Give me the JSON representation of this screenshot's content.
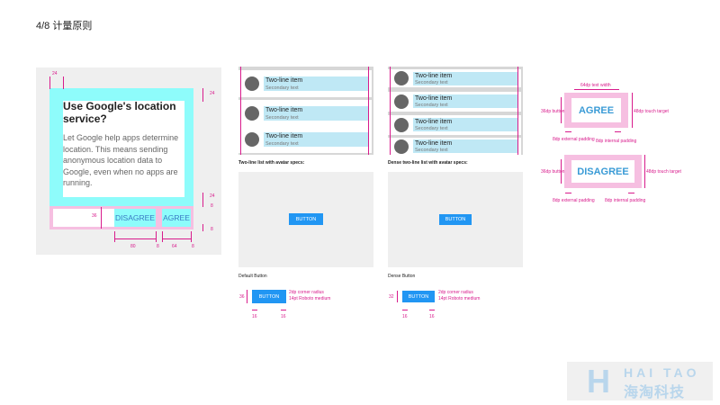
{
  "page_title": "4/8 计量原则",
  "dialog": {
    "title": "Use Google's location service?",
    "body": "Let Google help apps determine location. This means sending anonymous location data to Google, even when no apps are running.",
    "disagree_label": "DISAGREE",
    "agree_label": "AGREE",
    "dims": {
      "top_left": "24",
      "right_top": "24",
      "right_mid": "24",
      "right_8a": "8",
      "right_8b": "8",
      "btn_height": "36",
      "bottom_80": "80",
      "bottom_8a": "8",
      "bottom_64": "64",
      "bottom_8b": "8"
    }
  },
  "list_regular": {
    "caption": "Two-line list with avatar specs:",
    "items": [
      {
        "primary": "Two-line item",
        "secondary": "Secondary text"
      },
      {
        "primary": "Two-line item",
        "secondary": "Secondary text"
      },
      {
        "primary": "Two-line item",
        "secondary": "Secondary text"
      }
    ]
  },
  "list_dense": {
    "caption": "Dense two-line list with avatar specs:",
    "items": [
      {
        "primary": "Two-line item",
        "secondary": "Secondary text"
      },
      {
        "primary": "Two-line item",
        "secondary": "Secondary text"
      },
      {
        "primary": "Two-line item",
        "secondary": "Secondary text"
      },
      {
        "primary": "Two-line item",
        "secondary": "Secondary text"
      }
    ]
  },
  "default_button": {
    "caption": "Default Button",
    "label": "BUTTON",
    "spec_label": "BUTTON",
    "height": "36",
    "pad_left": "16",
    "pad_right": "16",
    "note1": "2dp corner radius",
    "note2": "14pt Roboto medium"
  },
  "dense_button": {
    "caption": "Dense Button",
    "label": "BUTTON",
    "spec_label": "BUTTON",
    "height": "32",
    "pad_left": "16",
    "pad_right": "16",
    "note1": "2dp corner radius",
    "note2": "14pt Roboto medium"
  },
  "touch_agree": {
    "label": "AGREE",
    "top_note": "64dp text width",
    "left_note": "36dp button",
    "right_note": "48dp touch target",
    "ext_padding": "8dp external padding",
    "int_padding": "8dp internal padding"
  },
  "touch_disagree": {
    "label": "DISAGREE",
    "left_note": "36dp button",
    "right_note": "48dp touch target",
    "ext_padding": "8dp external padding",
    "int_padding": "8dp internal padding"
  },
  "logo": {
    "mark": "H",
    "text_en": "HAI TAO",
    "text_cn": "海淘科技"
  },
  "colors": {
    "spec_magenta": "#d81b8c",
    "cyan_highlight": "#8efcfb",
    "pink_padding": "#f6bfe1",
    "button_blue": "#2196f3"
  }
}
